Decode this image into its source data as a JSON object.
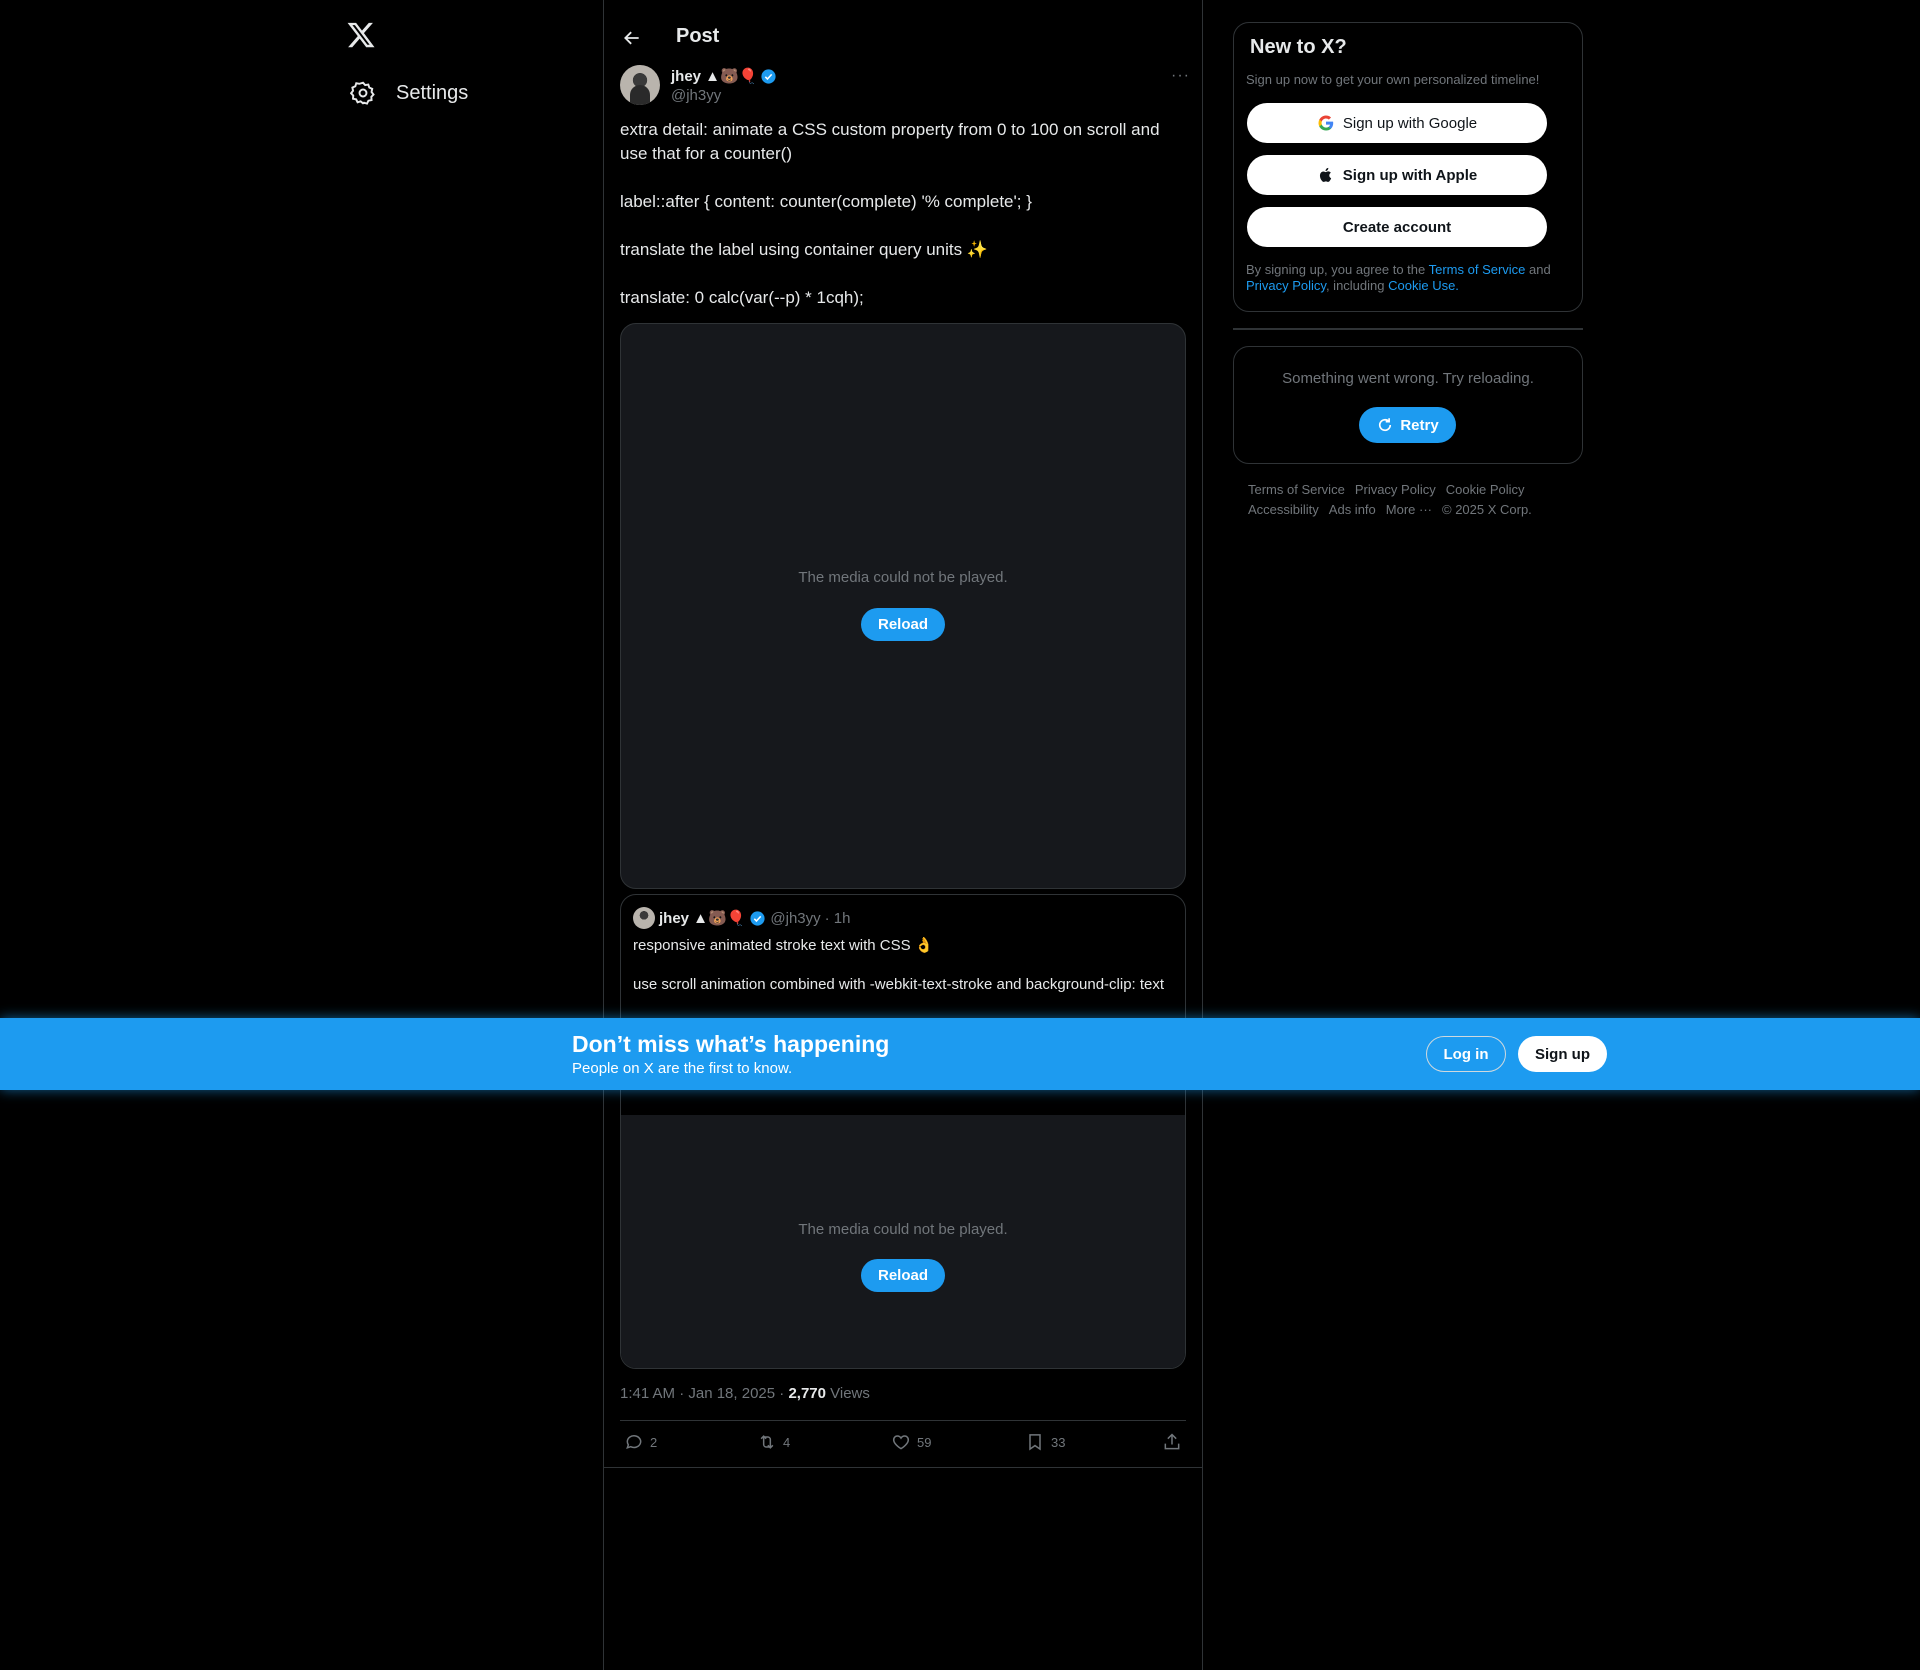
{
  "nav": {
    "logo": "x-logo-icon",
    "settings_label": "Settings"
  },
  "post": {
    "header_title": "Post",
    "author": {
      "name": "jhey ▲🐻🎈",
      "handle": "@jh3yy"
    },
    "more": "···",
    "paragraphs": [
      "extra detail: animate a CSS custom property from 0 to 100 on scroll and use that for a counter()",
      "label::after { content: counter(complete) '% complete'; }",
      "translate the label using container query units ✨",
      "translate: 0 calc(var(--p) * 1cqh);"
    ],
    "media": {
      "message": "The media could not be played.",
      "reload_label": "Reload"
    },
    "quote": {
      "name": "jhey ▲🐻🎈",
      "handle": "@jh3yy",
      "time": "· 1h",
      "line1": "responsive animated stroke text with CSS 👌",
      "line2": "use scroll animation combined with -webkit-text-stroke and background-clip: text",
      "media_message": "The media could not be played.",
      "reload_label": "Reload"
    },
    "meta": {
      "timestamp": "1:41 AM · Jan 18, 2025 · ",
      "views_count": "2,770",
      "views_label": " Views"
    },
    "actions": {
      "replies": "2",
      "reposts": "4",
      "likes": "59",
      "bookmarks": "33"
    }
  },
  "sidebar": {
    "signup": {
      "title": "New to X?",
      "subtitle": "Sign up now to get your own personalized timeline!",
      "google_label": "Sign up with Google",
      "apple_label": "Sign up with Apple",
      "create_label": "Create account",
      "legal_prefix": "By signing up, you agree to the ",
      "terms_link": "Terms of Service",
      "legal_and": " and ",
      "privacy_link": "Privacy Policy",
      "legal_including": ", including ",
      "cookie_link": "Cookie Use."
    },
    "error": {
      "message": "Something went wrong. Try reloading.",
      "retry_label": "Retry"
    },
    "footer": {
      "links": [
        "Terms of Service",
        "Privacy Policy",
        "Cookie Policy",
        "Accessibility",
        "Ads info",
        "More ···",
        "© 2025 X Corp."
      ]
    }
  },
  "banner": {
    "title": "Don’t miss what’s happening",
    "subtitle": "People on X are the first to know.",
    "login_label": "Log in",
    "signup_label": "Sign up"
  },
  "colors": {
    "accent": "#1d9bf0",
    "background": "#000000",
    "border": "#2f3336",
    "muted": "#71767b"
  }
}
